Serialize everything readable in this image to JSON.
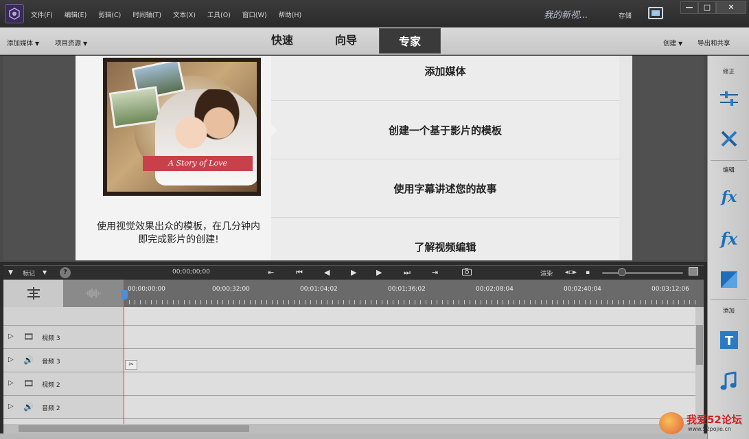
{
  "menu": [
    "文件(F)",
    "编辑(E)",
    "剪辑(C)",
    "时间轴(T)",
    "文本(X)",
    "工具(O)",
    "窗口(W)",
    "帮助(H)"
  ],
  "project_title": "我的新视...",
  "save_label": "存储",
  "window_controls": [
    "—",
    "□",
    "✕"
  ],
  "modebar": {
    "add_media": "添加媒体",
    "project_assets": "项目资源",
    "tabs": [
      "快速",
      "向导",
      "专家"
    ],
    "active_tab": "专家",
    "create": "创建",
    "export_share": "导出和共享"
  },
  "card": {
    "ribbon_text": "A Story of Love",
    "caption": "使用视觉效果出众的模板，在几分钟内即完成影片的创建!",
    "options": [
      "添加媒体",
      "创建一个基于影片的模板",
      "使用字幕讲述您的故事",
      "了解视频编辑"
    ]
  },
  "right_panel": {
    "section_adjust": "修正",
    "section_edit": "编辑",
    "section_add": "添加",
    "icons": [
      "sliders-icon",
      "tools-icon",
      "fx-edit-icon",
      "fx-icon",
      "transition-icon",
      "title-text-icon",
      "music-icon"
    ]
  },
  "timeline": {
    "marker_label": "标记",
    "help": "?",
    "timecode": "00;00;00;00",
    "render": "渲染",
    "ruler_labels": [
      "00;00;00;00",
      "00;00;32;00",
      "00;01;04;02",
      "00;01;36;02",
      "00;02;08;04",
      "00;02;40;04",
      "00;03;12;06"
    ],
    "tracks": [
      "视频 3",
      "音频 3",
      "视频 2",
      "音频 2"
    ]
  },
  "watermark": {
    "text": "我爱52论坛",
    "url": "www.52pojie.cn"
  }
}
